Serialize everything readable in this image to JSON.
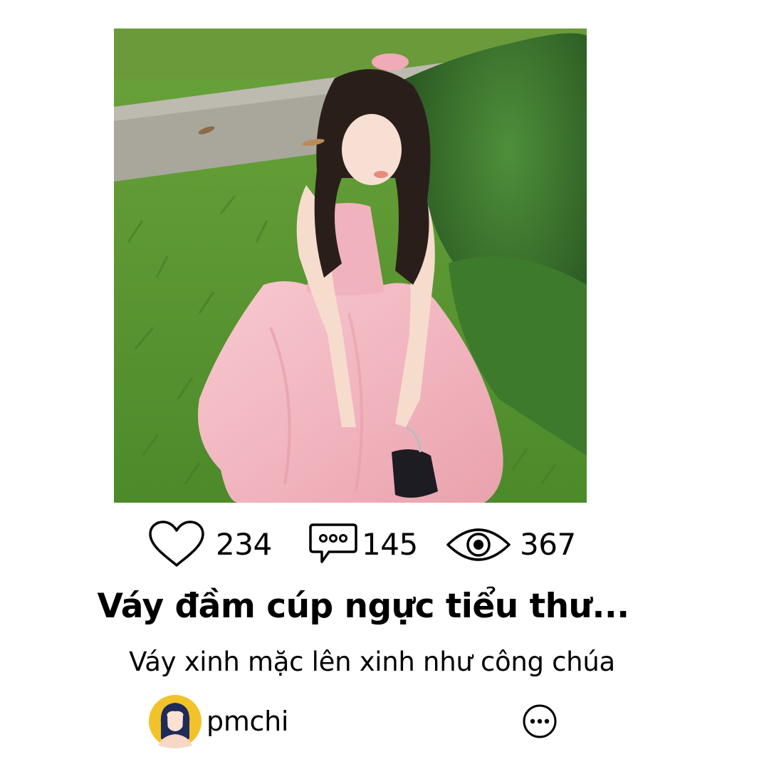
{
  "post": {
    "image_alt": "Girl in pink strapless dress sitting on grass",
    "stats": {
      "likes": "234",
      "comments": "145",
      "views": "367"
    },
    "title": "Váy đầm cúp ngực tiểu thư...",
    "subtitle": "Váy xinh mặc lên xinh như công chúa",
    "author": {
      "username": "pmchi",
      "avatar_color": "#f2c22b"
    },
    "icons": {
      "like": "heart-icon",
      "comment": "comment-bubble-icon",
      "view": "eye-icon",
      "more": "more-options-icon"
    }
  }
}
